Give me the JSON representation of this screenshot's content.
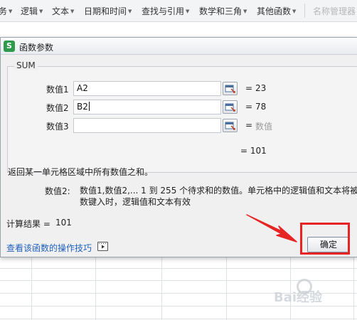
{
  "ribbon": {
    "items": [
      {
        "label": "务",
        "caret": true
      },
      {
        "label": "逻辑",
        "caret": true
      },
      {
        "label": "文本",
        "caret": true
      },
      {
        "label": "日期和时间",
        "caret": true
      },
      {
        "label": "查找与引用",
        "caret": true
      },
      {
        "label": "数学和三角",
        "caret": true
      },
      {
        "label": "其他函数",
        "caret": true
      },
      {
        "label": "名称管理器",
        "disabled": true
      }
    ]
  },
  "dialog": {
    "app_icon_letter": "S",
    "title": "函数参数",
    "function_name": "SUM",
    "args": [
      {
        "label": "数值1",
        "value": "A2",
        "equals": "=",
        "result": "23"
      },
      {
        "label": "数值2",
        "value": "B2",
        "equals": "=",
        "result": "78"
      },
      {
        "label": "数值3",
        "value": "",
        "equals": "=",
        "result": "数值"
      }
    ],
    "formula_result": "= 101",
    "description": "返回某一单元格区域中所有数值之和。",
    "param_name": "数值2:",
    "param_description_line1": "数值1,数值2,... 1 到 255 个待求和的数值。单元格中的逻辑值和文本将被忽",
    "param_description_line2": "数键入时，逻辑值和文本有效",
    "calc_label": "计算结果 =",
    "calc_value": "101",
    "help_link": "查看该函数的操作技巧",
    "ok_label": "确定"
  },
  "watermark": "Bai经验",
  "colors": {
    "annotation_red": "#e62424",
    "link_blue": "#1f5fbf",
    "app_green": "#2f9a4b"
  }
}
